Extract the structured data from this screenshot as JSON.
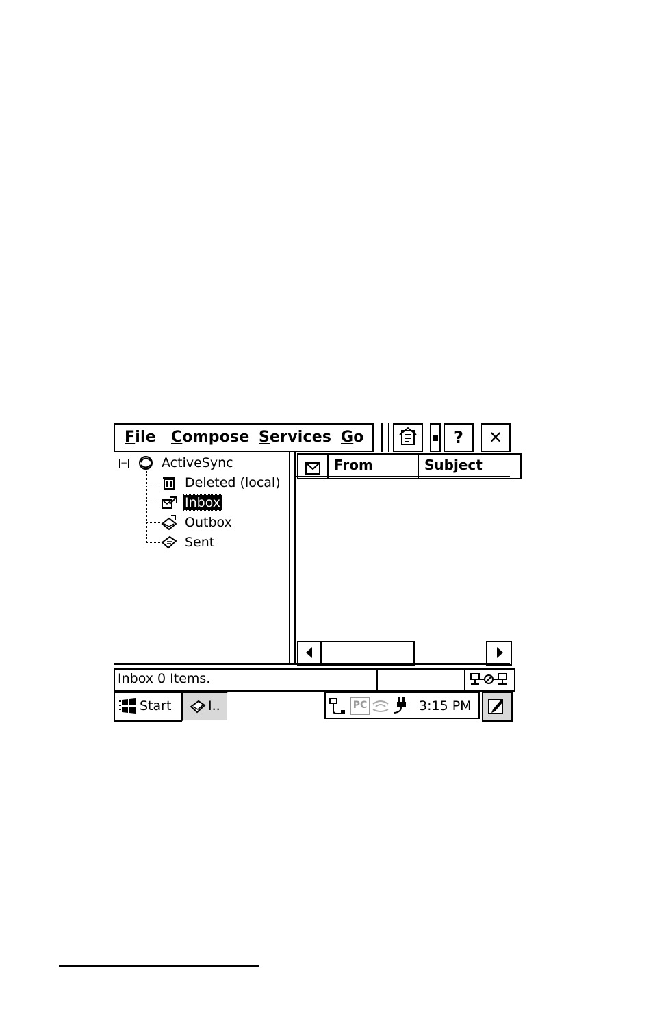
{
  "menu": {
    "file": {
      "accel": "F",
      "rest": "ile"
    },
    "compose": {
      "accel": "C",
      "rest": "ompose"
    },
    "services": {
      "accel": "S",
      "rest": "ervices"
    },
    "go": {
      "accel": "G",
      "rest": "o"
    }
  },
  "toolbar": {
    "help_label": "?",
    "close_label": "✕"
  },
  "tree": {
    "root": {
      "label": "ActiveSync",
      "expander": "⊟",
      "icon": "activesync-icon"
    },
    "children": [
      {
        "label": "Deleted (local)",
        "icon": "trash-icon"
      },
      {
        "label": "Inbox",
        "icon": "inbox-icon",
        "selected": true
      },
      {
        "label": "Outbox",
        "icon": "outbox-icon"
      },
      {
        "label": "Sent",
        "icon": "sent-icon"
      }
    ]
  },
  "list": {
    "columns": [
      "From",
      "Subject"
    ]
  },
  "status": {
    "text": "Inbox 0 Items."
  },
  "taskbar": {
    "start_label": "Start",
    "task_label": "I..",
    "clock": "3:15 PM",
    "tray_pc_label": "PC"
  }
}
